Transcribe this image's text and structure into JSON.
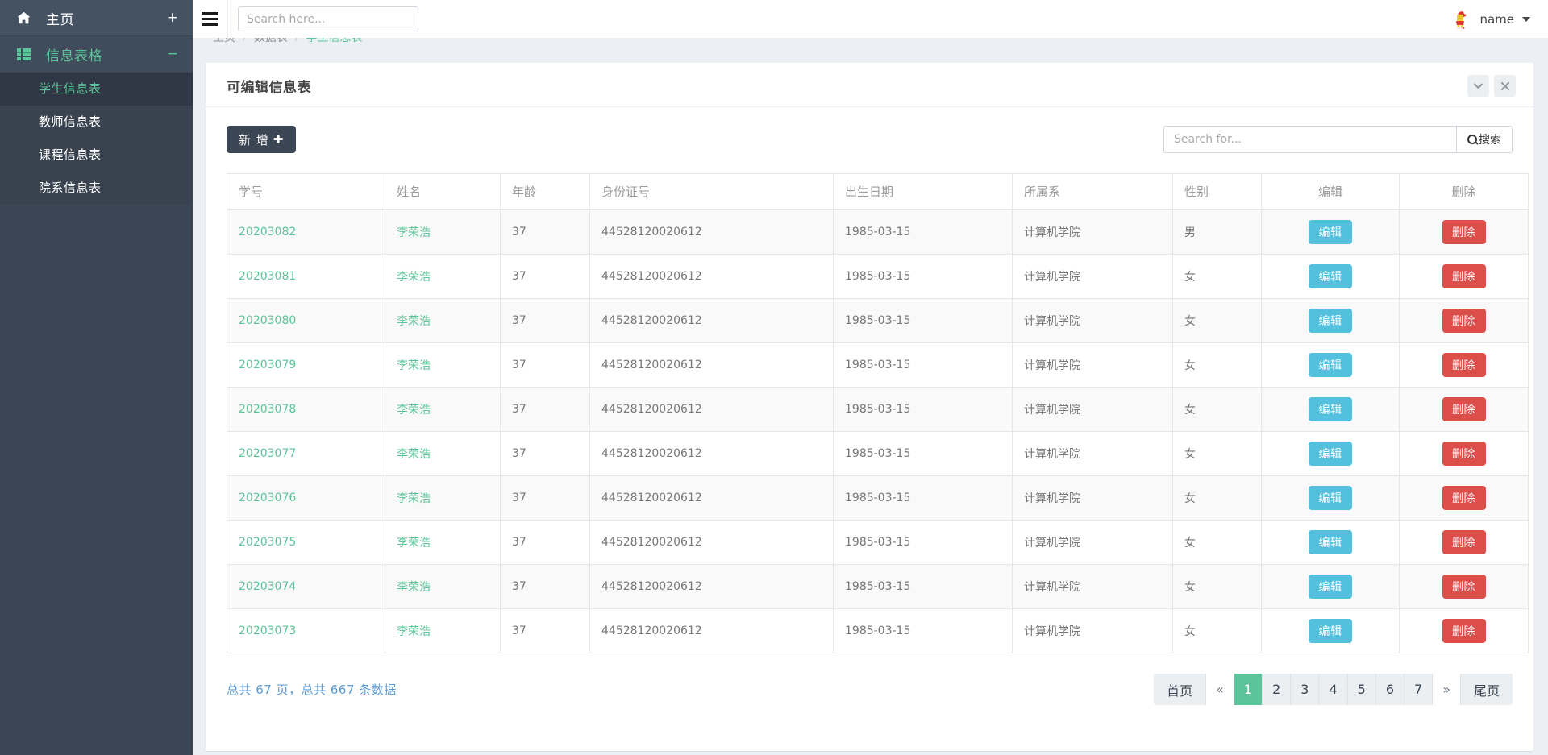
{
  "topbar": {
    "menu_toggle": "hamburger-menu",
    "search_placeholder": "Search here...",
    "search_value": "",
    "user_name": "name"
  },
  "sidebar": {
    "home": {
      "label": "主页",
      "sign": "+"
    },
    "section": {
      "label": "信息表格",
      "sign": "−"
    },
    "sub_items": [
      {
        "label": "学生信息表",
        "active": true
      },
      {
        "label": "教师信息表",
        "active": false
      },
      {
        "label": "课程信息表",
        "active": false
      },
      {
        "label": "院系信息表",
        "active": false
      }
    ]
  },
  "breadcrumb": {
    "items": [
      {
        "label": "主页",
        "current": false
      },
      {
        "label": "数据表",
        "current": false
      },
      {
        "label": "学生信息表",
        "current": true
      }
    ],
    "separator": "/"
  },
  "panel": {
    "title": "可编辑信息表",
    "collapse_icon": "chevron-down-icon",
    "close_icon": "close-icon"
  },
  "toolbar": {
    "add_label": "新 增",
    "add_plus": "✚",
    "search_placeholder": "Search for...",
    "search_value": "",
    "search_button_label": "搜索"
  },
  "table": {
    "columns": [
      {
        "key": "id",
        "label": "学号",
        "align": "left"
      },
      {
        "key": "name",
        "label": "姓名",
        "align": "left"
      },
      {
        "key": "age",
        "label": "年龄",
        "align": "left"
      },
      {
        "key": "idcard",
        "label": "身份证号",
        "align": "left"
      },
      {
        "key": "dob",
        "label": "出生日期",
        "align": "left"
      },
      {
        "key": "dept",
        "label": "所属系",
        "align": "left"
      },
      {
        "key": "sex",
        "label": "性别",
        "align": "left"
      },
      {
        "key": "edit",
        "label": "编辑",
        "align": "center"
      },
      {
        "key": "del",
        "label": "删除",
        "align": "center"
      }
    ],
    "rows": [
      {
        "id": "20203082",
        "name": "李荣浩",
        "age": "37",
        "idcard": "44528120020612",
        "dob": "1985-03-15",
        "dept": "计算机学院",
        "sex": "男"
      },
      {
        "id": "20203081",
        "name": "李荣浩",
        "age": "37",
        "idcard": "44528120020612",
        "dob": "1985-03-15",
        "dept": "计算机学院",
        "sex": "女"
      },
      {
        "id": "20203080",
        "name": "李荣浩",
        "age": "37",
        "idcard": "44528120020612",
        "dob": "1985-03-15",
        "dept": "计算机学院",
        "sex": "女"
      },
      {
        "id": "20203079",
        "name": "李荣浩",
        "age": "37",
        "idcard": "44528120020612",
        "dob": "1985-03-15",
        "dept": "计算机学院",
        "sex": "女"
      },
      {
        "id": "20203078",
        "name": "李荣浩",
        "age": "37",
        "idcard": "44528120020612",
        "dob": "1985-03-15",
        "dept": "计算机学院",
        "sex": "女"
      },
      {
        "id": "20203077",
        "name": "李荣浩",
        "age": "37",
        "idcard": "44528120020612",
        "dob": "1985-03-15",
        "dept": "计算机学院",
        "sex": "女"
      },
      {
        "id": "20203076",
        "name": "李荣浩",
        "age": "37",
        "idcard": "44528120020612",
        "dob": "1985-03-15",
        "dept": "计算机学院",
        "sex": "女"
      },
      {
        "id": "20203075",
        "name": "李荣浩",
        "age": "37",
        "idcard": "44528120020612",
        "dob": "1985-03-15",
        "dept": "计算机学院",
        "sex": "女"
      },
      {
        "id": "20203074",
        "name": "李荣浩",
        "age": "37",
        "idcard": "44528120020612",
        "dob": "1985-03-15",
        "dept": "计算机学院",
        "sex": "女"
      },
      {
        "id": "20203073",
        "name": "李荣浩",
        "age": "37",
        "idcard": "44528120020612",
        "dob": "1985-03-15",
        "dept": "计算机学院",
        "sex": "女"
      }
    ],
    "row_edit_label": "编辑",
    "row_delete_label": "删除"
  },
  "footer": {
    "total_text": "总共 67 页，总共 667 条数据",
    "pager": [
      {
        "label": "首页",
        "type": "word"
      },
      {
        "label": "«",
        "type": "arrow"
      },
      {
        "label": "1",
        "type": "page",
        "active": true
      },
      {
        "label": "2",
        "type": "page"
      },
      {
        "label": "3",
        "type": "page"
      },
      {
        "label": "4",
        "type": "page"
      },
      {
        "label": "5",
        "type": "page"
      },
      {
        "label": "6",
        "type": "page"
      },
      {
        "label": "7",
        "type": "page"
      },
      {
        "label": "»",
        "type": "arrow"
      },
      {
        "label": "尾页",
        "type": "word"
      }
    ]
  },
  "colors": {
    "sidebar_bg": "#3b4654",
    "accent_green": "#5cc49a",
    "edit_blue": "#53c0de",
    "delete_red": "#dc4e4a",
    "page_bg": "#ecf0f5",
    "link_blue": "#5b9bd5"
  }
}
